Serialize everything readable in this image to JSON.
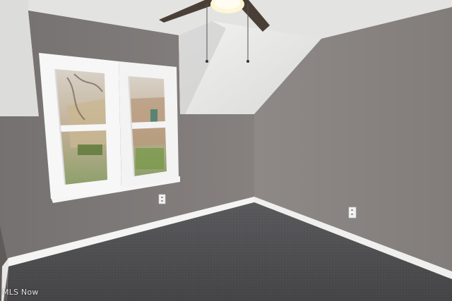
{
  "watermark": {
    "text": "MLS Now"
  },
  "colors": {
    "wall_left": "#807b79",
    "wall_right": "#8a8583",
    "ceiling": "#e6e6e4",
    "carpet": "#4f4f52",
    "baseboard": "#f4f4f2",
    "window_frame": "#f7f7f7"
  }
}
